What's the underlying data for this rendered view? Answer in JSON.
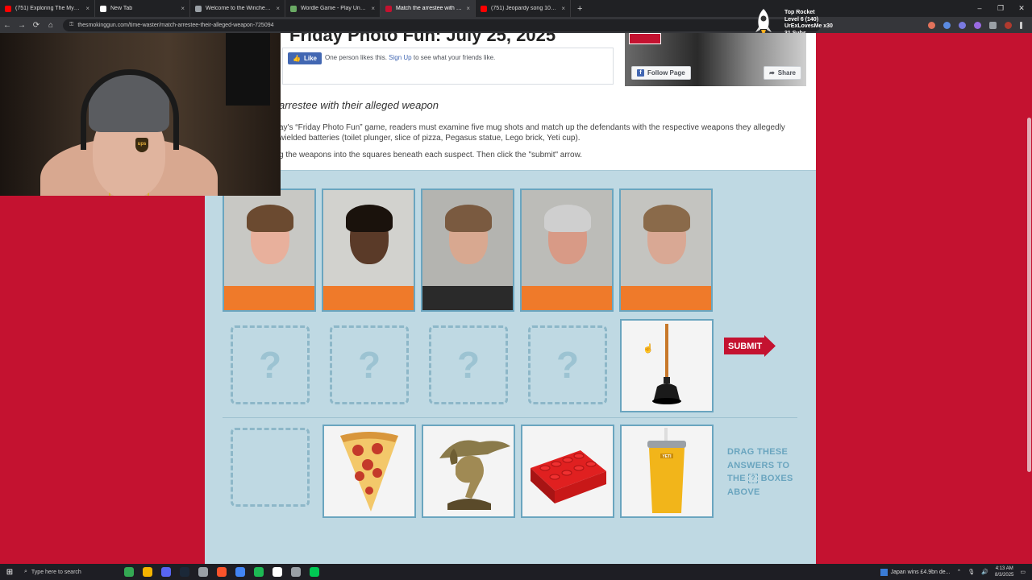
{
  "browser": {
    "tabs": [
      {
        "title": "(751) Exploring The Mystery Sp",
        "favicon_color": "#ff0000",
        "active": false
      },
      {
        "title": "New Tab",
        "favicon_color": "#ffffff",
        "active": false
      },
      {
        "title": "Welcome to the Winchester M",
        "favicon_color": "#9aa0a6",
        "active": false
      },
      {
        "title": "Wordle Game - Play Unlimited",
        "favicon_color": "#6aaa64",
        "active": false
      },
      {
        "title": "Match the arrestee with their a",
        "favicon_color": "#c41230",
        "active": true
      },
      {
        "title": "(751) Jeopardy song 10 hours l",
        "favicon_color": "#ff0000",
        "active": false
      }
    ],
    "tab_close_glyph": "×",
    "new_tab_glyph": "+",
    "window_controls": [
      "–",
      "❐",
      "✕"
    ],
    "url": "thesmokinggun.com/time-waster/match-arrestee-their-alleged-weapon-725094",
    "nav_glyphs": [
      "←",
      "→",
      "⟳",
      "⌂"
    ]
  },
  "overlay": {
    "title": "Top Rocket",
    "level": "Level 6  (140)",
    "user": "UrExLovesMe x30",
    "subs": "31 Subs"
  },
  "article": {
    "headline": "Friday Photo Fun: July 25, 2025",
    "fb_like_label": "Like",
    "fb_like_text": "One person likes this.",
    "fb_signup_link": "Sign Up",
    "fb_signup_rest": "to see what your friends like.",
    "fb_follow_label": "Follow Page",
    "fb_share_label": "Share",
    "subhead": "arrestee with their alleged weapon",
    "intro": "ay's “Friday Photo Fun” game, readers must examine five mug shots and match up the defendants with the respective weapons they allegedly wielded batteries (toilet plunger, slice of pizza, Pegasus statue, Lego brick, Yeti cup).",
    "instructions": "g the weapons into the squares beneath each suspect. Then click the \"submit\" arrow."
  },
  "game": {
    "suspects": [
      {
        "name": "suspect-1",
        "bg": "#c8c8c4",
        "skin": "#e8b09c",
        "hair": "#6b4a30"
      },
      {
        "name": "suspect-2",
        "bg": "#d2d2ce",
        "skin": "#5a3a28",
        "hair": "#1a120c"
      },
      {
        "name": "suspect-3",
        "bg": "#b4b4b0",
        "skin": "#d8a890",
        "hair": "#7a5a40"
      },
      {
        "name": "suspect-4",
        "bg": "#bcbcb8",
        "skin": "#d89a86",
        "hair": "#cfcfcf"
      },
      {
        "name": "suspect-5",
        "bg": "#c4c4c0",
        "skin": "#d9a894",
        "hair": "#8a6a4a"
      }
    ],
    "slot_glyph": "?",
    "placed_answer": "plunger",
    "submit_label": "SUBMIT",
    "answers": [
      "pizza",
      "pegasus",
      "lego",
      "yeti"
    ],
    "drag_note": [
      "DRAG THESE",
      "ANSWERS TO",
      "BOXES",
      "ABOVE"
    ],
    "drag_note_the": "THE",
    "drag_note_q": "?",
    "yeti_label": "YETI"
  },
  "taskbar": {
    "search_placeholder": "Type here to search",
    "news": "Japan wins £4.9bn de...",
    "time": "4:13 AM",
    "date": "8/3/2025",
    "apps": [
      "#34a853",
      "#f4b400",
      "#5865f2",
      "#1b2838",
      "#9aa0a6",
      "#fb542b",
      "#4285f4",
      "#1db954",
      "#ffffff",
      "#9aa0a6",
      "#00c853"
    ]
  },
  "colors": {
    "brand_red": "#c41230",
    "game_bg": "#bfd9e3",
    "frame_blue": "#6aa5bf"
  }
}
